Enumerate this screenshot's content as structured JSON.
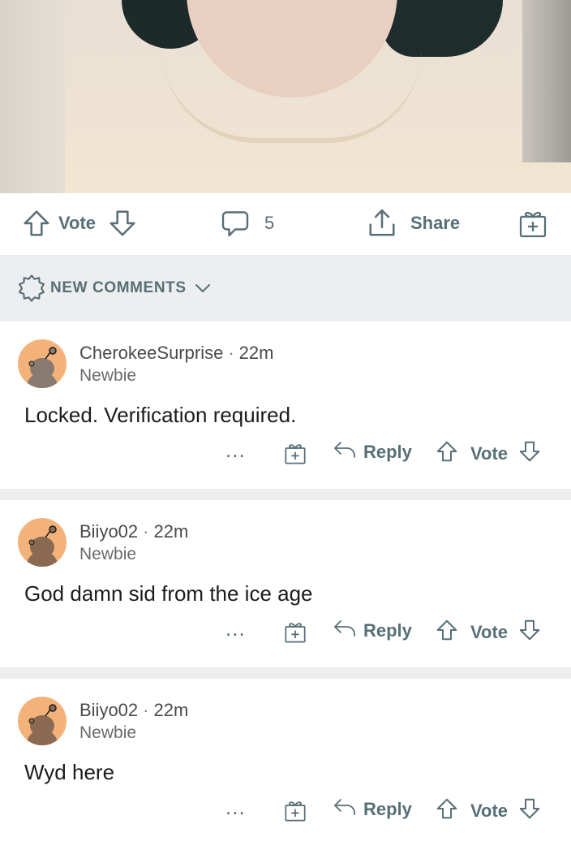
{
  "post": {
    "actions": {
      "vote_label": "Vote",
      "comments_count": "5",
      "share_label": "Share"
    }
  },
  "sort": {
    "label": "NEW COMMENTS"
  },
  "comments": [
    {
      "username": "CherokeeSurprise",
      "time": "22m",
      "flair": "Newbie",
      "body": "Locked. Verification required.",
      "more": "...",
      "reply_label": "Reply",
      "vote_label": "Vote"
    },
    {
      "username": "Biiyo02",
      "time": "22m",
      "flair": "Newbie",
      "body": "God damn sid from the ice age",
      "more": "...",
      "reply_label": "Reply",
      "vote_label": "Vote"
    },
    {
      "username": "Biiyo02",
      "time": "22m",
      "flair": "Newbie",
      "body": "Wyd here",
      "more": "...",
      "reply_label": "Reply",
      "vote_label": "Vote"
    }
  ],
  "colors": {
    "action_gray": "#576f76",
    "avatar_orange": "#f3b27a",
    "divider_gray": "#eceef0"
  }
}
